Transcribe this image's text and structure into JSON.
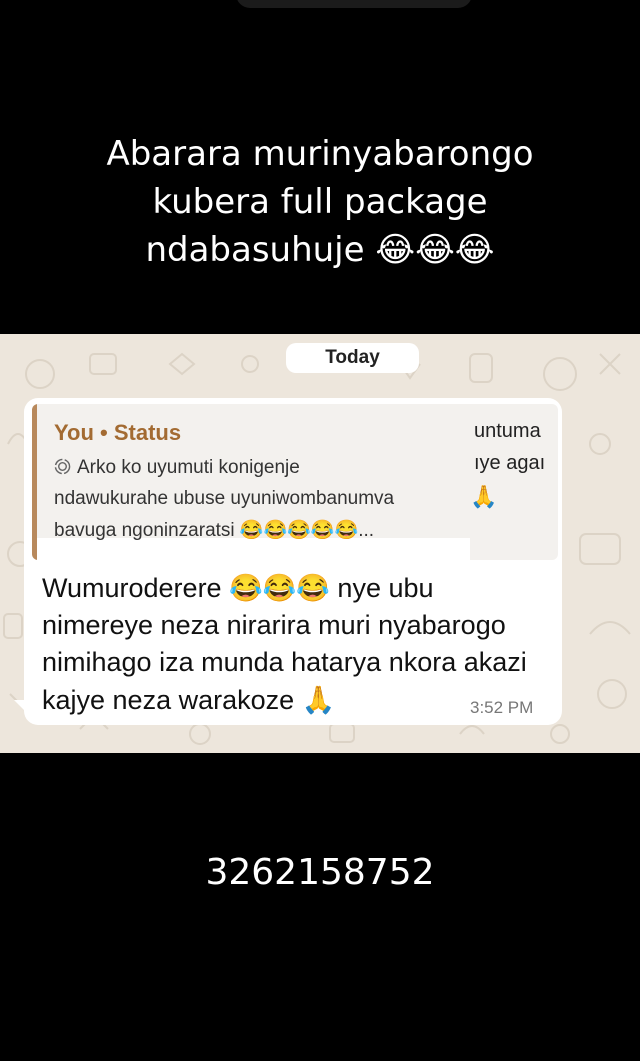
{
  "caption": {
    "line1": "Abarara murinyabarongo",
    "line2": "kubera full package",
    "line3": "ndabasuhuje 😂😂😂"
  },
  "chat": {
    "date_pill": "Today",
    "quoted_reply": {
      "author": "You • Status",
      "line1": "Arko ko uyumuti konigenje",
      "line2": "ndawukurahe ubuse uyuniwombanumva",
      "line3": "bavuga ngoninzaratsi 😂😂😂😂😂...",
      "peek_line1": "untuma",
      "peek_line2": "ıye agaı",
      "peek_emoji": "🙏"
    },
    "message": {
      "line1": "Wumuroderere 😂😂😂 nye ubu",
      "line2": "nimereye neza nirarira muri nyabarogo",
      "line3": "nimihago iza munda hatarya nkora akazi",
      "line4": "kajye neza warakoze 🙏",
      "time": "3:52 PM"
    }
  },
  "footer_number": "3262158752",
  "colors": {
    "background": "#000000",
    "chat_wallpaper": "#ede6dc",
    "bubble": "#ffffff",
    "quote_accent": "#b8895c",
    "quote_author": "#a36b32"
  },
  "icons": {
    "status": "status-ring-icon"
  }
}
